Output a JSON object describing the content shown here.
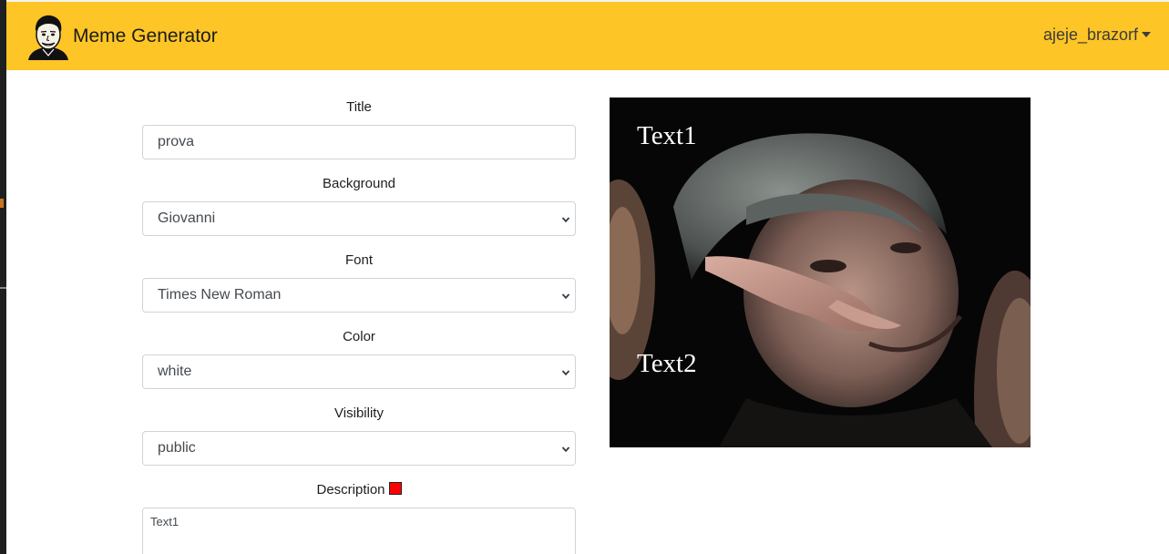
{
  "navbar": {
    "brand_title": "Meme Generator",
    "brand_logo_icon": "cartoon-face-logo-icon",
    "user_name": "ajeje_brazorf",
    "background_color": "#fec526"
  },
  "form": {
    "title": {
      "label": "Title",
      "value": "prova"
    },
    "background": {
      "label": "Background",
      "selected": "Giovanni"
    },
    "font": {
      "label": "Font",
      "selected": "Times New Roman"
    },
    "color": {
      "label": "Color",
      "selected": "white"
    },
    "visibility": {
      "label": "Visibility",
      "selected": "public"
    },
    "description": {
      "label": "Description",
      "indicator_color": "#ff0000",
      "value": "Text1"
    }
  },
  "meme": {
    "text1": "Text1",
    "text2": "Text2",
    "text_color": "#ffffff",
    "background_image": "man-gesturing-hand-photo"
  }
}
